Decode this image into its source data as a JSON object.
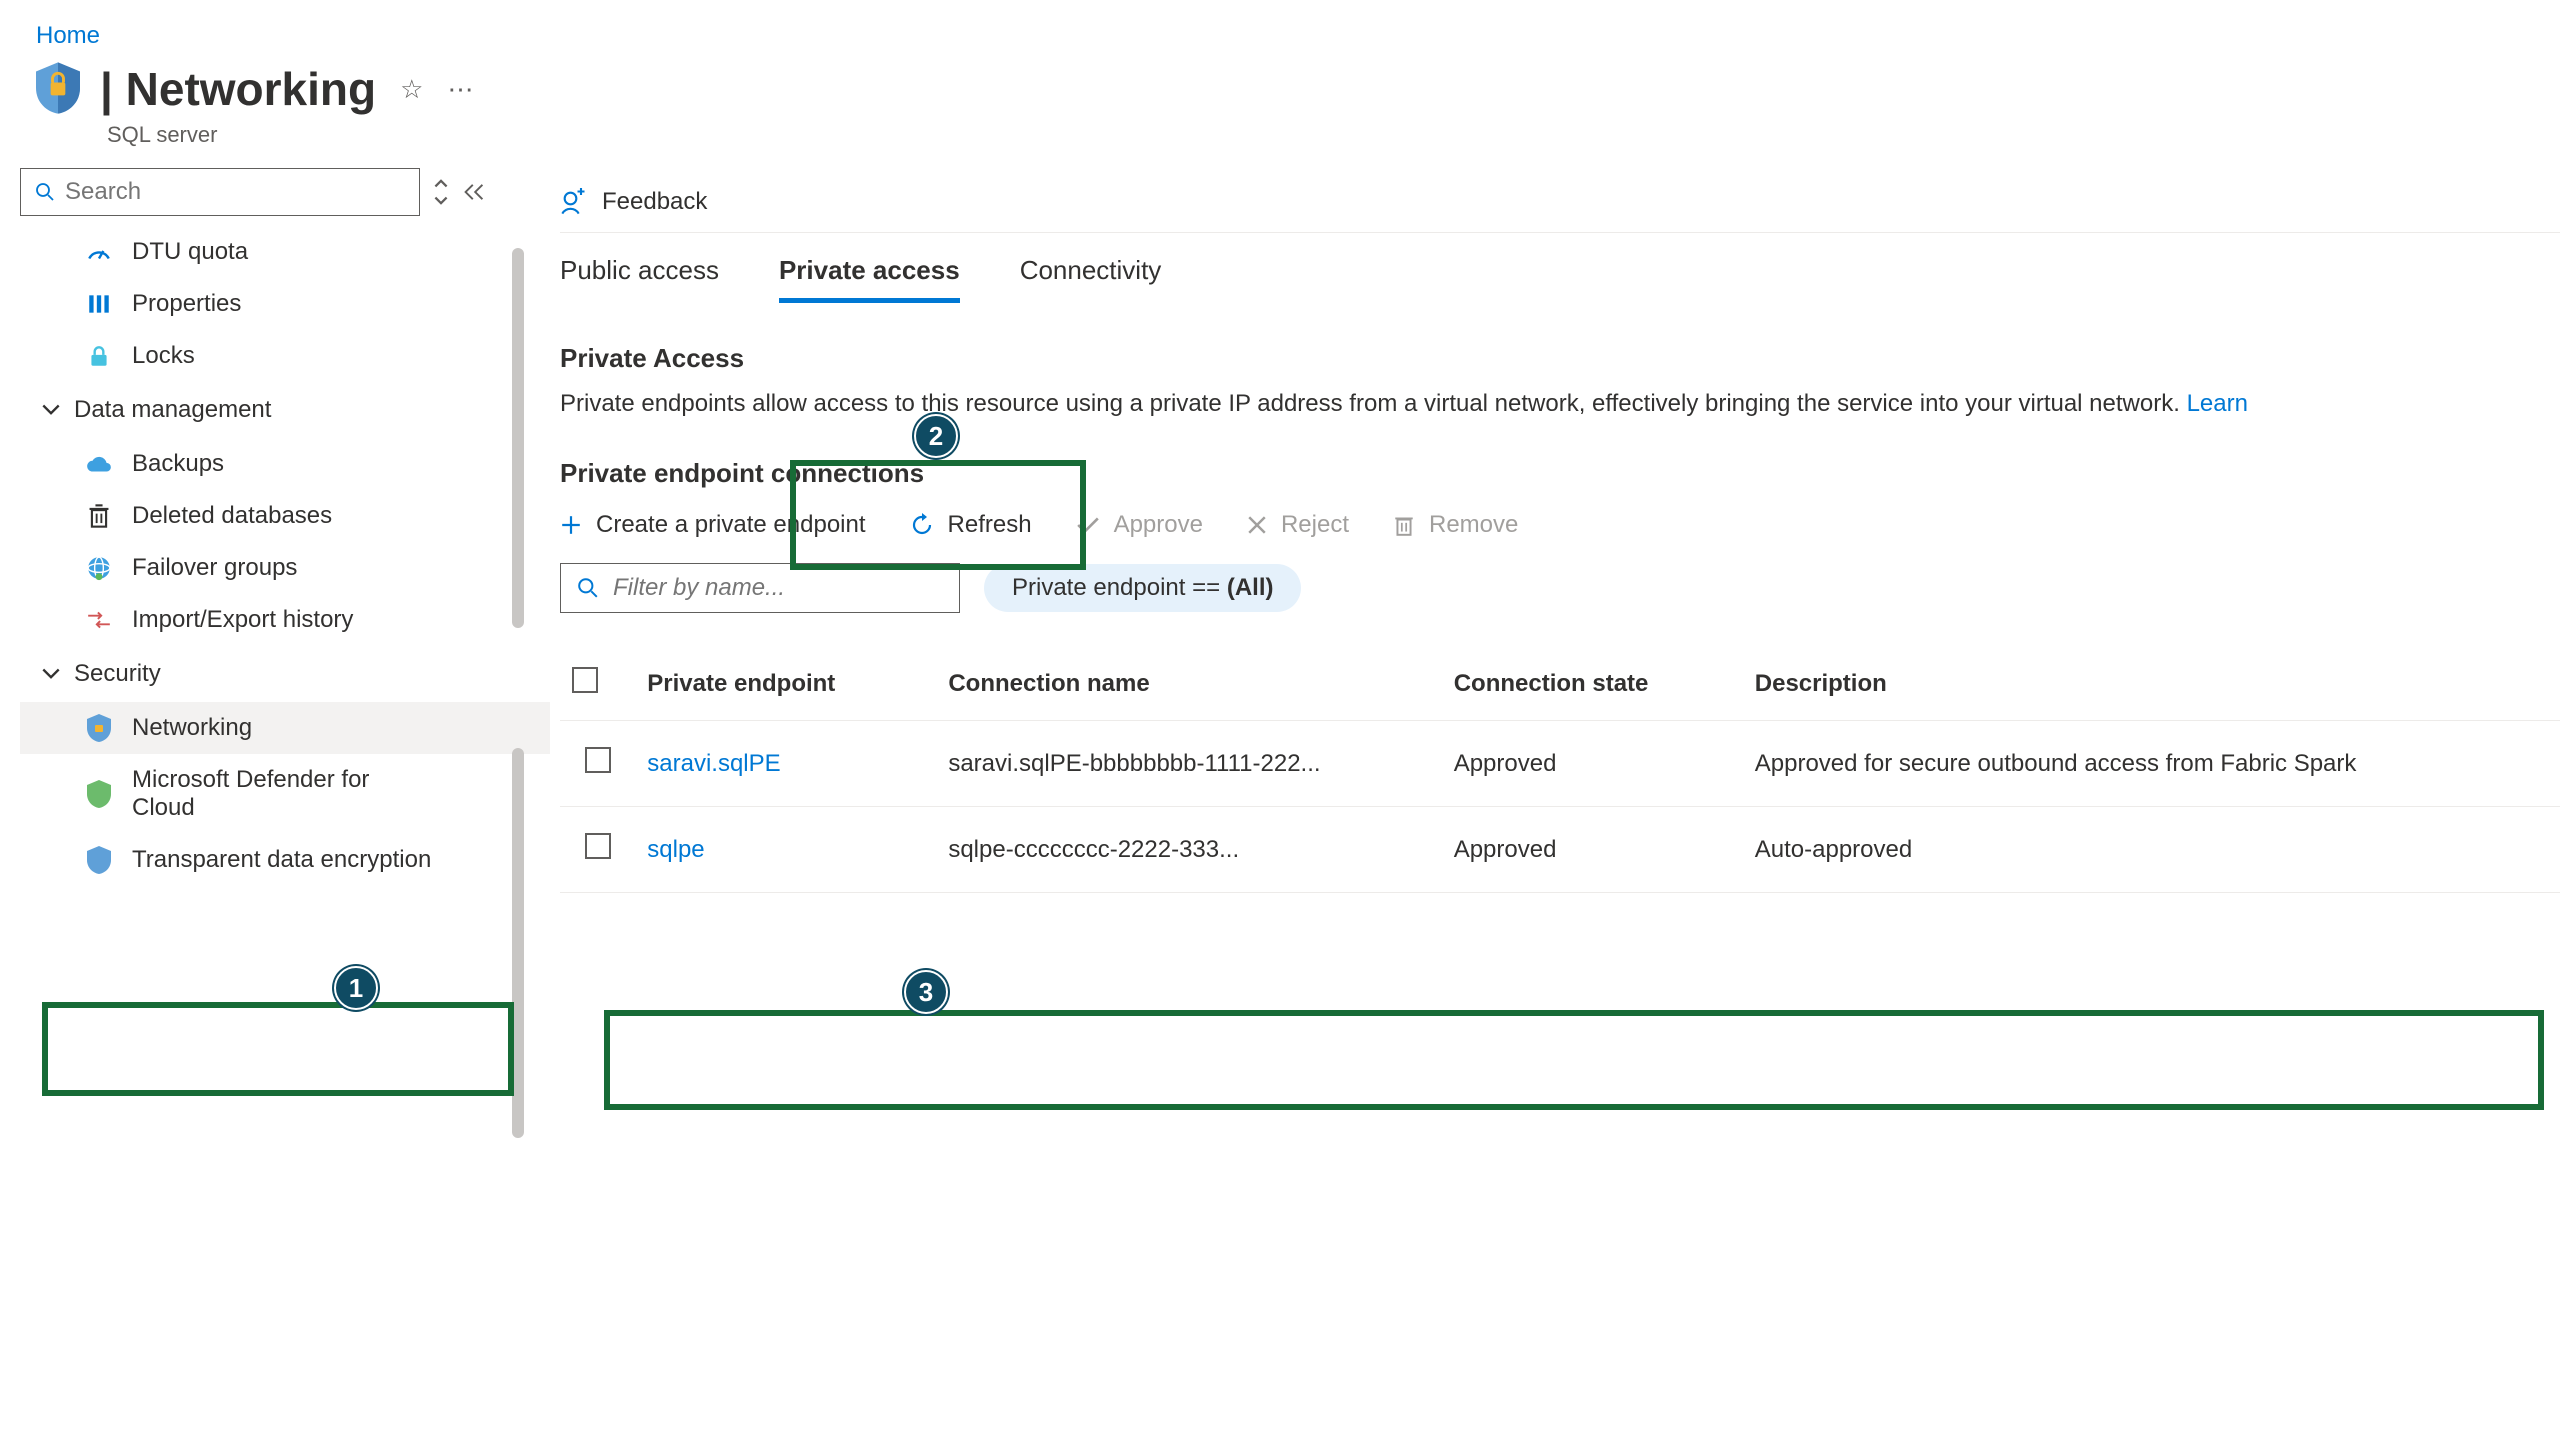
{
  "breadcrumb": {
    "home": "Home"
  },
  "header": {
    "title": "| Networking",
    "subtitle": "SQL server"
  },
  "sidebar": {
    "search_placeholder": "Search",
    "items": [
      {
        "icon": "gauge",
        "label": "DTU quota"
      },
      {
        "icon": "props",
        "label": "Properties"
      },
      {
        "icon": "lock",
        "label": "Locks"
      }
    ],
    "section_data_mgmt": "Data management",
    "data_mgmt_items": [
      {
        "icon": "cloud",
        "label": "Backups"
      },
      {
        "icon": "trash",
        "label": "Deleted databases"
      },
      {
        "icon": "globe",
        "label": "Failover groups"
      },
      {
        "icon": "io",
        "label": "Import/Export history"
      }
    ],
    "section_security": "Security",
    "security_items": [
      {
        "icon": "shield",
        "label": "Networking",
        "selected": true
      },
      {
        "icon": "defender",
        "label": "Microsoft Defender for Cloud"
      },
      {
        "icon": "tde",
        "label": "Transparent data encryption"
      }
    ]
  },
  "content": {
    "feedback": "Feedback",
    "tabs": {
      "public": "Public access",
      "private": "Private access",
      "connectivity": "Connectivity"
    },
    "section_title": "Private Access",
    "section_desc": "Private endpoints allow access to this resource using a private IP address from a virtual network, effectively bringing the service into your virtual network.",
    "learn_more": "Learn",
    "subsection_title": "Private endpoint connections",
    "actions": {
      "create": "Create a private endpoint",
      "refresh": "Refresh",
      "approve": "Approve",
      "reject": "Reject",
      "remove": "Remove"
    },
    "filter_placeholder": "Filter by name...",
    "pill_prefix": "Private endpoint == ",
    "pill_value": "(All)",
    "table": {
      "headers": {
        "pe": "Private endpoint",
        "cn": "Connection name",
        "cs": "Connection state",
        "desc": "Description"
      },
      "rows": [
        {
          "pe": "saravi.sqlPE",
          "cn": "saravi.sqlPE-bbbbbbbb-1111-222...",
          "cs": "Approved",
          "desc": "Approved for secure outbound access from Fabric Spark"
        },
        {
          "pe": "sqlpe",
          "cn": "sqlpe-cccccccc-2222-333...",
          "cs": "Approved",
          "desc": "Auto-approved"
        }
      ]
    }
  },
  "annotations": {
    "b1": "1",
    "b2": "2",
    "b3": "3"
  }
}
